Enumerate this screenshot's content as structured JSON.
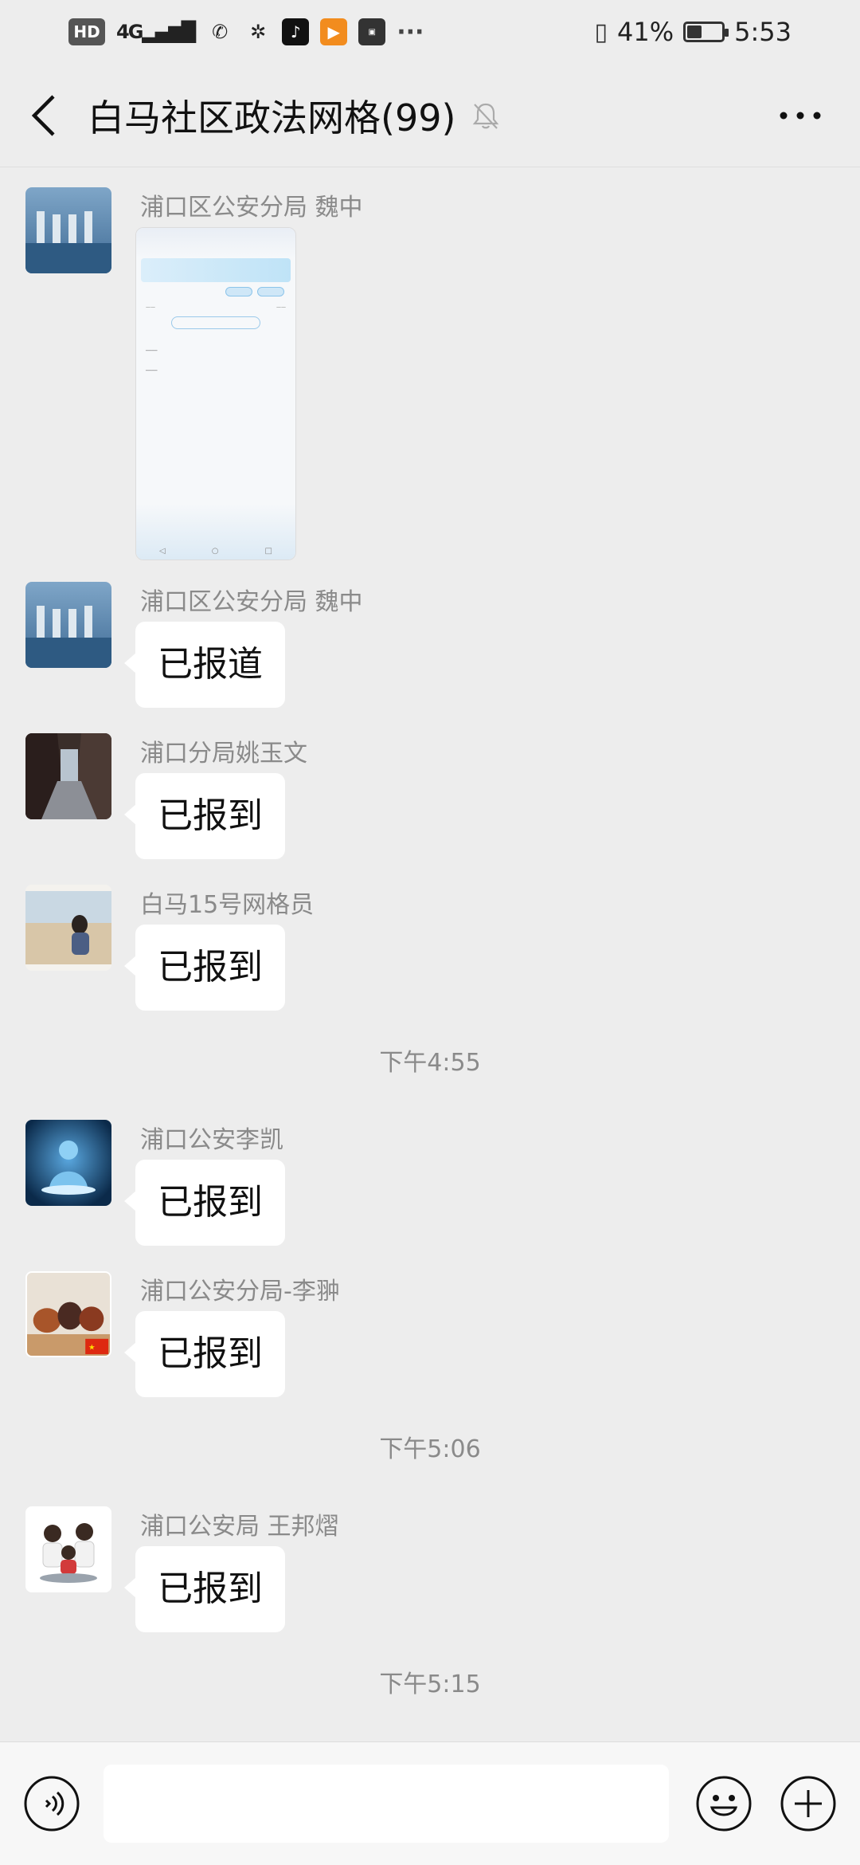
{
  "status_bar": {
    "hd": "HD",
    "network": "4G",
    "dots": "···",
    "battery_percent": "41%",
    "battery_level": 0.41,
    "time": "5:53"
  },
  "header": {
    "title": "白马社区政法网格(99)"
  },
  "messages": [
    {
      "sender": "浦口区公安分局  魏中",
      "type": "image"
    },
    {
      "sender": "浦口区公安分局  魏中",
      "text": "已报道"
    },
    {
      "sender": "浦口分局姚玉文",
      "text": "已报到"
    },
    {
      "sender": "白马15号网格员",
      "text": "已报到"
    },
    {
      "sender": "浦口公安李凯",
      "text": "已报到"
    },
    {
      "sender": "浦口公安分局-李翀",
      "text": "已报到"
    },
    {
      "sender": "浦口公安局 王邦熠",
      "text": "已报到"
    }
  ],
  "timestamps": [
    "下午4:55",
    "下午5:06",
    "下午5:15"
  ],
  "input": {
    "value": "",
    "placeholder": ""
  },
  "colors": {
    "background": "#ededed",
    "bubble": "#ffffff",
    "meta_text": "#8a8a8a"
  }
}
